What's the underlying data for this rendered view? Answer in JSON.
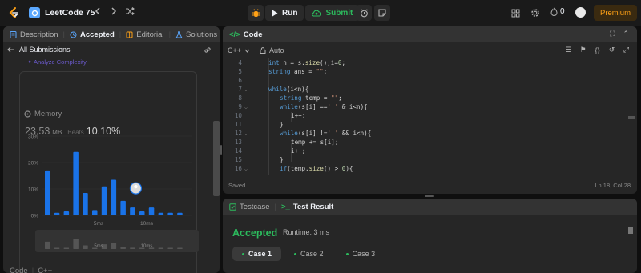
{
  "topbar": {
    "problem_list_title": "LeetCode 75",
    "run_label": "Run",
    "submit_label": "Submit",
    "streak_count": "0",
    "premium_label": "Premium"
  },
  "left_panel": {
    "tabs": [
      {
        "label": "Description"
      },
      {
        "label": "Accepted"
      },
      {
        "label": "Editorial"
      },
      {
        "label": "Solutions"
      }
    ],
    "all_submissions_label": "All Submissions",
    "analyze_label": "Analyze Complexity",
    "memory_title": "Memory",
    "memory_value": "23.53",
    "memory_unit": "MB",
    "beats_label": "Beats",
    "beats_value": "10.10%",
    "bottom_lang_label": "Code",
    "bottom_lang_value": "C++"
  },
  "chart_data": {
    "type": "bar",
    "y_ticks": [
      "30%",
      "20%",
      "10%",
      "0%"
    ],
    "ylim": [
      0,
      30
    ],
    "x_tick_labels": [
      "5ms",
      "10ms"
    ],
    "mini_tick_labels": [
      "5ms",
      "10ms"
    ],
    "values": [
      17,
      1,
      1.5,
      24,
      8.5,
      2,
      11,
      13.5,
      5.5,
      3,
      1.5,
      3,
      1,
      1,
      1
    ],
    "highlight_index": 9,
    "bar_color": "#1a73e8"
  },
  "code_panel": {
    "title": "Code",
    "language": "C++",
    "autocomplete": "Auto",
    "saved_label": "Saved",
    "cursor_position": "Ln 18, Col 28",
    "lines": [
      {
        "n": "4",
        "text": "int n = s.size(),i=0;"
      },
      {
        "n": "5",
        "text": "string ans = \"\";"
      },
      {
        "n": "6",
        "text": ""
      },
      {
        "n": "7",
        "text": "while(i<n){"
      },
      {
        "n": "8",
        "text": "string temp = \"\";"
      },
      {
        "n": "9",
        "text": "while(s[i] ==' ' & i<n){"
      },
      {
        "n": "10",
        "text": "i++;"
      },
      {
        "n": "11",
        "text": "}"
      },
      {
        "n": "12",
        "text": "while(s[i] !=' ' && i<n){"
      },
      {
        "n": "13",
        "text": "temp += s[i];"
      },
      {
        "n": "14",
        "text": "i++;"
      },
      {
        "n": "15",
        "text": "}"
      },
      {
        "n": "16",
        "text": "if(temp.size() > 0){"
      }
    ]
  },
  "result_panel": {
    "tabs": [
      {
        "label": "Testcase"
      },
      {
        "label": "Test Result"
      }
    ],
    "status": "Accepted",
    "runtime": "Runtime: 3 ms",
    "cases": [
      {
        "label": "Case 1"
      },
      {
        "label": "Case 2"
      },
      {
        "label": "Case 3"
      }
    ]
  }
}
